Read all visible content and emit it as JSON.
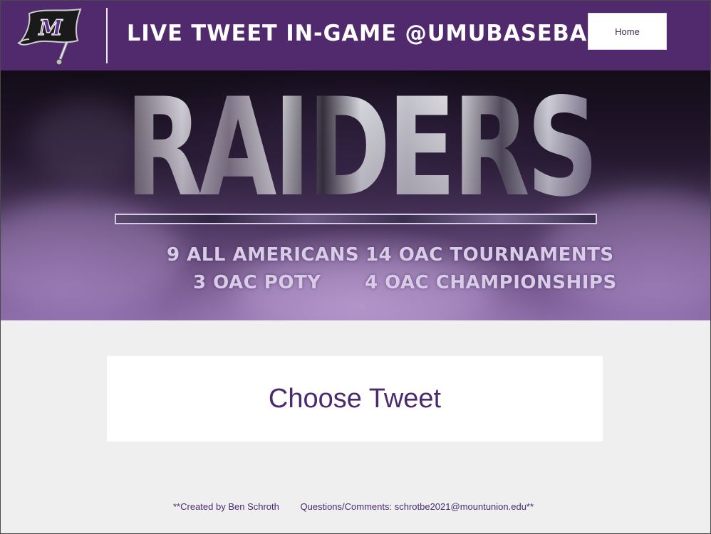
{
  "header": {
    "title": "LIVE TWEET IN-GAME @UMUBASEBALL",
    "home_label": "Home",
    "logo_letter": "M"
  },
  "banner": {
    "word": "RAIDERS",
    "stats": [
      "9 ALL AMERICANS",
      "3 OAC POTY",
      "14 OAC TOURNAMENTS",
      "4 OAC CHAMPIONSHIPS"
    ]
  },
  "main": {
    "choose_label": "Choose Tweet"
  },
  "footer": {
    "credit": "**Created by Ben Schroth",
    "contact": "Questions/Comments: schrotbe2021@mountunion.edu**"
  },
  "colors": {
    "brand_purple": "#512a6e",
    "text_purple": "#4b2a70",
    "page_bg": "#efefef"
  }
}
